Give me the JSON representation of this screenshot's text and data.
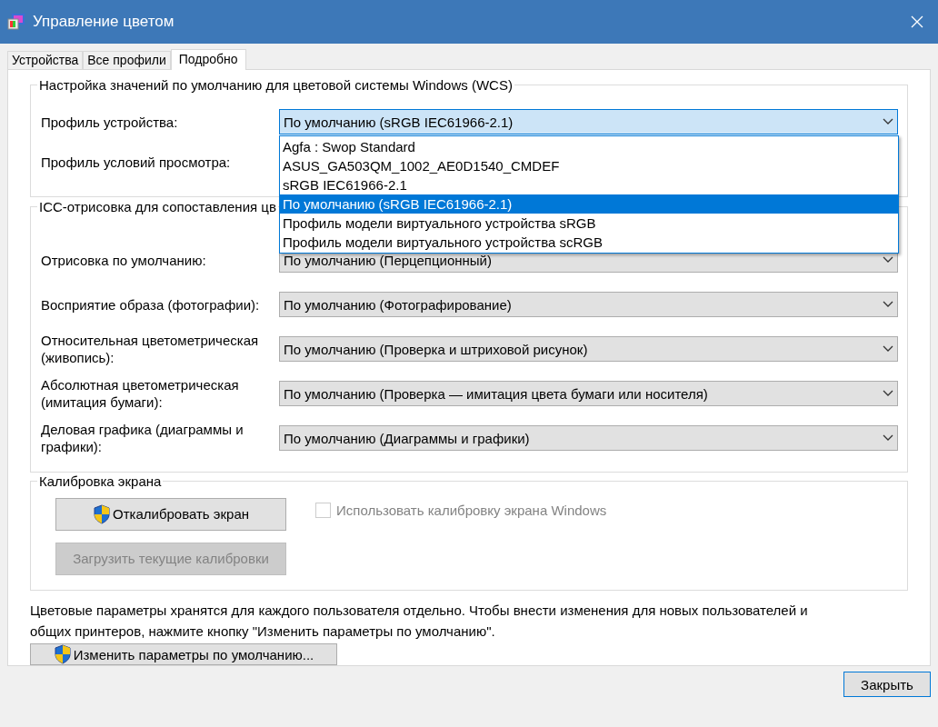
{
  "window": {
    "title": "Управление цветом"
  },
  "tabs": [
    {
      "label": "Устройства",
      "selected": false
    },
    {
      "label": "Все профили",
      "selected": false
    },
    {
      "label": "Подробно",
      "selected": true
    }
  ],
  "wcs_group": {
    "title": "Настройка значений по умолчанию для цветовой системы Windows (WCS)",
    "rows": [
      {
        "label": "Профиль устройства:",
        "value": "По умолчанию (sRGB IEC61966-2.1)",
        "open": true
      },
      {
        "label": "Профиль условий просмотра:"
      }
    ]
  },
  "dropdown": {
    "options": [
      {
        "label": "Agfa : Swop Standard",
        "selected": false
      },
      {
        "label": "ASUS_GA503QM_1002_AE0D1540_CMDEF",
        "selected": false
      },
      {
        "label": "sRGB IEC61966-2.1",
        "selected": false
      },
      {
        "label": "По умолчанию (sRGB IEC61966-2.1)",
        "selected": true
      },
      {
        "label": "Профиль модели виртуального устройства sRGB",
        "selected": false
      },
      {
        "label": "Профиль модели виртуального устройства scRGB",
        "selected": false
      }
    ]
  },
  "icc_group": {
    "title": "ICC-отрисовка для сопоставления цв",
    "rows": [
      {
        "label": "Отрисовка по умолчанию:",
        "value": "По умолчанию (Перцепционный)"
      },
      {
        "label": "Восприятие образа (фотографии):",
        "value": "По умолчанию (Фотографирование)"
      },
      {
        "label": "Относительная цветометрическая (живопись):",
        "value": "По умолчанию (Проверка и штриховой рисунок)"
      },
      {
        "label": "Абсолютная цветометрическая (имитация бумаги):",
        "value": "По умолчанию (Проверка — имитация цвета бумаги или носителя)"
      },
      {
        "label": "Деловая графика (диаграммы и графики):",
        "value": "По умолчанию (Диаграммы и графики)"
      }
    ]
  },
  "calibration": {
    "title": "Калибровка экрана",
    "buttons": [
      {
        "label": "Откалибровать экран",
        "shield": true,
        "disabled": false
      },
      {
        "label": "Загрузить текущие калибровки",
        "shield": false,
        "disabled": true
      }
    ],
    "checkbox": {
      "label": "Использовать калибровку экрана Windows",
      "checked": false,
      "disabled": true
    }
  },
  "note": "Цветовые параметры хранятся для каждого пользователя отдельно. Чтобы внести изменения для новых пользователей и общих принтеров, нажмите кнопку \"Изменить параметры по умолчанию\".",
  "defaults_button": {
    "label": "Изменить параметры по умолчанию...",
    "shield": true
  },
  "close_button": {
    "label": "Закрыть"
  }
}
